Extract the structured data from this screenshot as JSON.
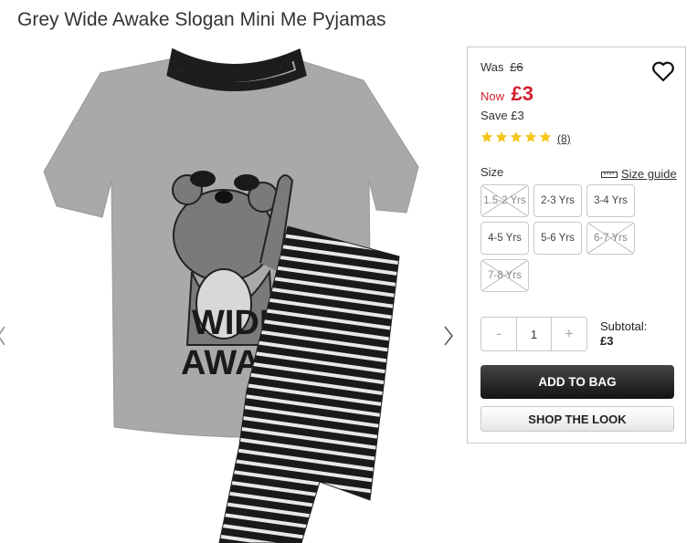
{
  "product": {
    "title": "Grey Wide Awake Slogan Mini Me Pyjamas"
  },
  "gallery": {
    "image_name": "grey-pyjamas-image",
    "print_line1": "WIDE",
    "print_line2": "AWAKE",
    "prev_icon": "chevron-left-icon",
    "next_icon": "chevron-right-icon"
  },
  "pricing": {
    "was_label": "Was",
    "was_price": "£6",
    "now_label": "Now",
    "now_price": "£3",
    "save_label": "Save",
    "save_amount": "£3",
    "sale_color": "#d0202f"
  },
  "rating": {
    "stars": 5,
    "max": 5,
    "review_count": "(8)",
    "star_color": "#f5c518"
  },
  "wishlist": {
    "icon": "heart-icon"
  },
  "size": {
    "label": "Size",
    "guide_label": "Size guide",
    "guide_icon": "ruler-icon",
    "options": [
      {
        "label": "1.5-2 Yrs",
        "available": false
      },
      {
        "label": "2-3 Yrs",
        "available": true
      },
      {
        "label": "3-4 Yrs",
        "available": true
      },
      {
        "label": "4-5 Yrs",
        "available": true
      },
      {
        "label": "5-6 Yrs",
        "available": true
      },
      {
        "label": "6-7 Yrs",
        "available": false
      },
      {
        "label": "7-8 Yrs",
        "available": false
      }
    ]
  },
  "quantity": {
    "minus": "-",
    "value": "1",
    "plus": "+"
  },
  "subtotal": {
    "label": "Subtotal:",
    "amount": "£3"
  },
  "actions": {
    "add_to_bag": "ADD TO BAG",
    "shop_the_look": "SHOP THE LOOK"
  }
}
